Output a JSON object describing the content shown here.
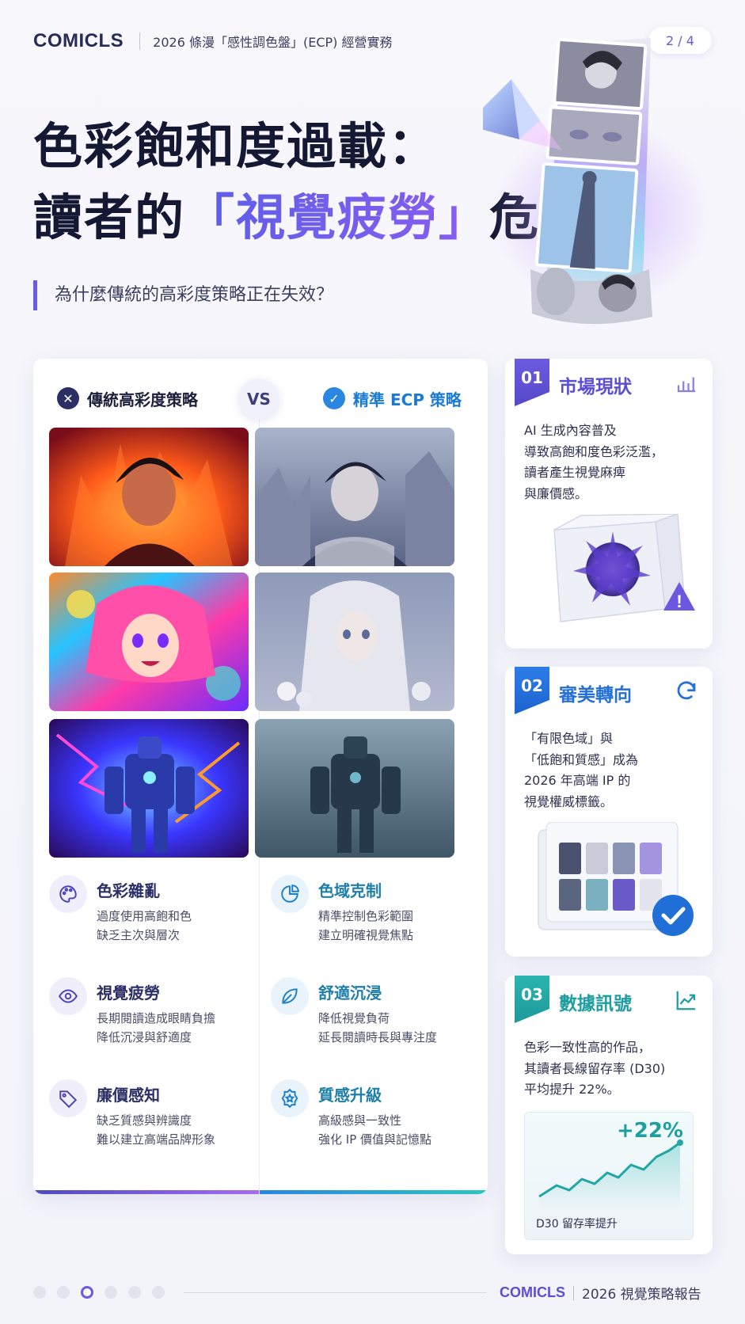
{
  "header": {
    "brand": "COMICLS",
    "report_title": "2026 條漫「感性調色盤」(ECP) 經營實務",
    "page_counter": "2 / 4"
  },
  "hero": {
    "title_line1": "色彩飽和度過載：",
    "title_line2_pre": "讀者的",
    "title_line2_accent": "「視覺疲勞」",
    "title_line2_post": "危機",
    "subtitle": "為什麼傳統的高彩度策略正在失效？"
  },
  "compare": {
    "left_heading": "傳統高彩度策略",
    "vs": "VS",
    "right_heading": "精準 ECP 策略",
    "left_features": [
      {
        "title": "色彩雜亂",
        "desc": "過度使用高飽和色\n缺乏主次與層次",
        "icon": "palette-icon"
      },
      {
        "title": "視覺疲勞",
        "desc": "長期閱讀造成眼睛負擔\n降低沉浸與舒適度",
        "icon": "eye-icon"
      },
      {
        "title": "廉價感知",
        "desc": "缺乏質感與辨識度\n難以建立高端品牌形象",
        "icon": "price-tag-icon"
      }
    ],
    "right_features": [
      {
        "title": "色域克制",
        "desc": "精準控制色彩範圍\n建立明確視覺焦點",
        "icon": "pie-chart-icon"
      },
      {
        "title": "舒適沉浸",
        "desc": "降低視覺負荷\n延長閱讀時長與專注度",
        "icon": "leaf-icon"
      },
      {
        "title": "質感升級",
        "desc": "高級感與一致性\n強化 IP 價值與記憶點",
        "icon": "quality-badge-icon"
      }
    ]
  },
  "cards": [
    {
      "num": "01",
      "title": "市場現狀",
      "body": "AI 生成內容普及\n導致高飽和度色彩泛濫，\n讀者產生視覺麻痺\n與廉價感。",
      "icon": "bar-chart-icon"
    },
    {
      "num": "02",
      "title": "審美轉向",
      "body": "「有限色域」與\n「低飽和質感」成為\n2026 年高端 IP 的\n視覺權威標籤。",
      "icon": "refresh-icon"
    },
    {
      "num": "03",
      "title": "數據訊號",
      "body": "色彩一致性高的作品，\n其讀者長線留存率 (D30)\n平均提升 22%。",
      "icon": "trend-up-icon",
      "chart_value": "+22%",
      "chart_label": "D30 留存率提升"
    }
  ],
  "footer": {
    "brand": "COMICLS",
    "label": "2026 視覺策略報告",
    "active_page": 3,
    "page_count": 6
  }
}
